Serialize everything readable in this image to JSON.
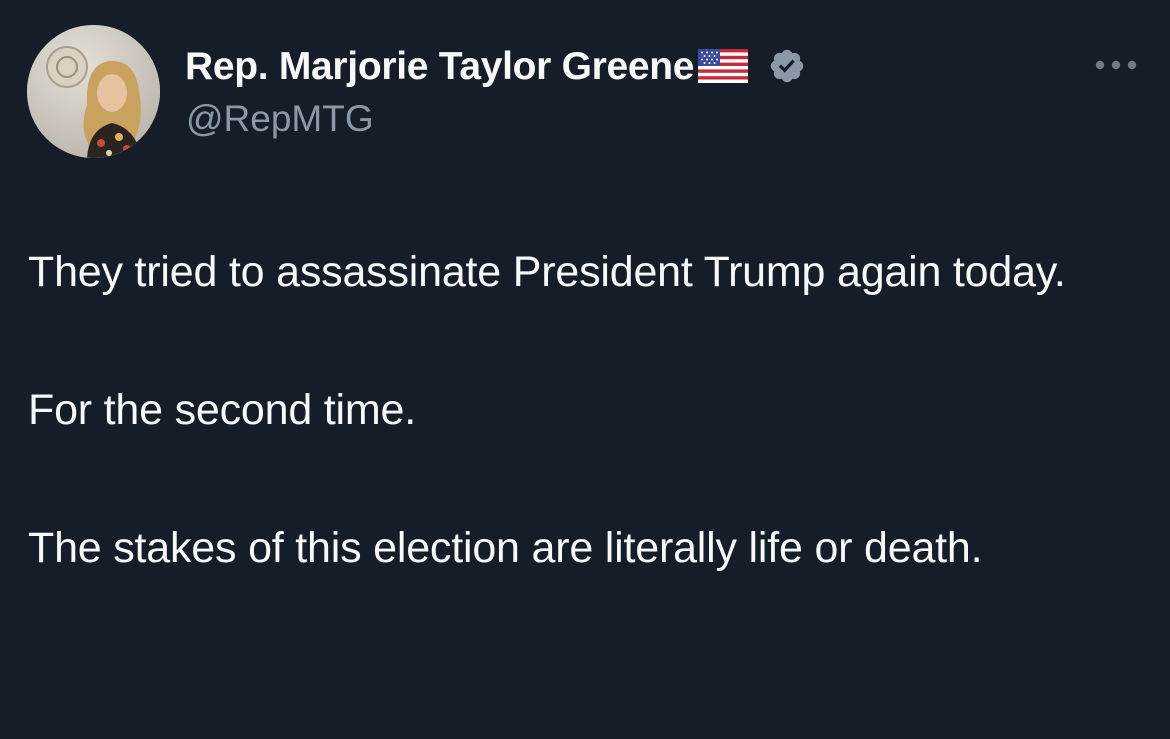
{
  "tweet": {
    "author": {
      "display_name": "Rep. Marjorie Taylor Greene",
      "handle": "@RepMTG",
      "verified": true,
      "flag_emoji": "us-flag-icon",
      "avatar": "profile-photo"
    },
    "more_icon": "more-options-icon",
    "paragraphs": [
      "They tried to assassinate President Trump again today.",
      "For the second time.",
      "The stakes of this election are literally life or death."
    ]
  },
  "colors": {
    "background": "#151d29",
    "text_primary": "#f7f9f9",
    "text_secondary": "#8b98a5",
    "verified_badge": "#8b98a5"
  }
}
